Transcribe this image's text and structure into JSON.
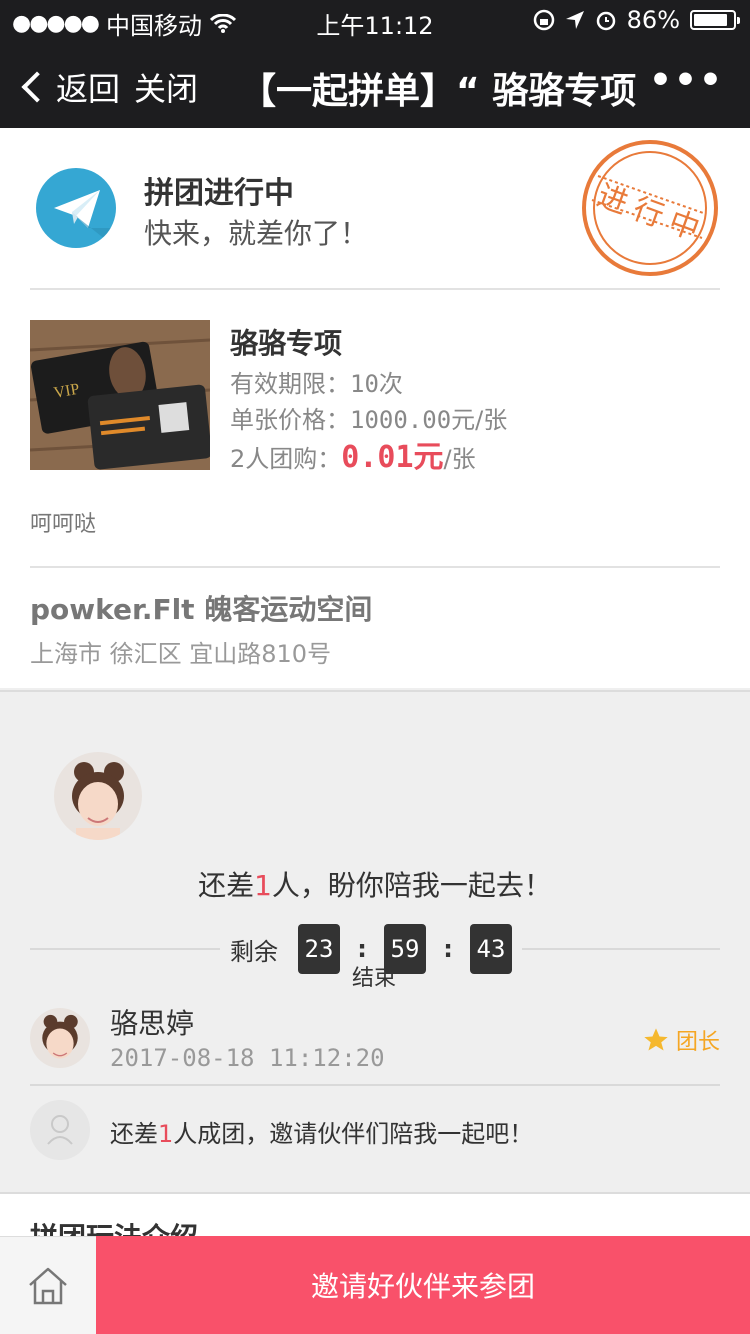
{
  "status_bar": {
    "signal_dots": "●●●●●",
    "carrier": "中国移动",
    "time": "上午11:12",
    "battery_percent": "86%",
    "battery_level": 0.86
  },
  "nav": {
    "back_label": "返回",
    "close_label": "关闭",
    "title": "【一起拼单】“ 骆骆专项",
    "more_label": "•••"
  },
  "status": {
    "title": "拼团进行中",
    "subtitle": "快来，就差你了！",
    "stamp_text": "进行中",
    "accent": "#e87a3a",
    "icon_color": "#35a7d3"
  },
  "product": {
    "name": "骆骆专项",
    "validity_label": "有效期限：",
    "validity_value": "10次",
    "unit_price_label": "单张价格：",
    "unit_price_value": "1000.00",
    "unit_price_unit": "元/张",
    "group_label": "2人团购：",
    "group_price": "0.01元",
    "group_unit": "/张",
    "description": "呵呵哒",
    "price_color": "#e84c5b"
  },
  "store": {
    "name": "powker.Flt 魄客运动空间",
    "address": "上海市  徐汇区  宜山路810号"
  },
  "group": {
    "need_prefix": "还差",
    "need_count": "1",
    "need_suffix": "人，盼你陪我一起去！",
    "timer_label": "剩余",
    "hours": "23",
    "minutes": "59",
    "seconds": "43",
    "sep": ":",
    "end_label": "结束",
    "leader": {
      "name": "骆思婷",
      "joined_at": "2017-08-18 11:12:20",
      "badge": "团长"
    },
    "invite_prefix": "还差",
    "invite_count": "1",
    "invite_suffix": "人成团，邀请伙伴们陪我一起吧！"
  },
  "intro": {
    "title": "拼团玩法介绍"
  },
  "bottom": {
    "home_icon": "home-icon",
    "invite_label": "邀请好伙伴来参团",
    "button_color": "#f9516a"
  }
}
